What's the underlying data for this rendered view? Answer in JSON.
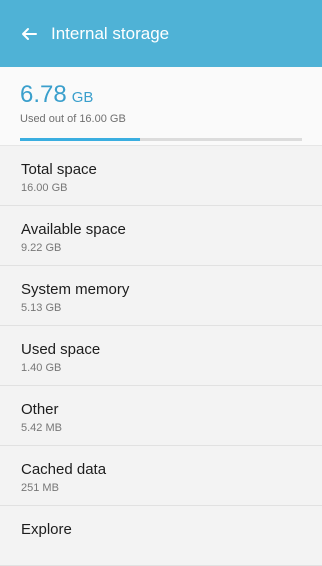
{
  "header": {
    "title": "Internal storage",
    "back_icon": "arrow-left-icon"
  },
  "summary": {
    "used_value": "6.78",
    "used_unit": "GB",
    "used_caption": "Used out of 16.00 GB",
    "usage_fraction": 0.424
  },
  "items": [
    {
      "label": "Total space",
      "value": "16.00 GB"
    },
    {
      "label": "Available space",
      "value": "9.22 GB"
    },
    {
      "label": "System memory",
      "value": "5.13 GB"
    },
    {
      "label": "Used space",
      "value": "1.40 GB"
    },
    {
      "label": "Other",
      "value": "5.42 MB"
    },
    {
      "label": "Cached data",
      "value": "251 MB"
    },
    {
      "label": "Explore",
      "value": ""
    }
  ],
  "colors": {
    "accent": "#4fb2d6",
    "progress": "#3aaee0"
  }
}
